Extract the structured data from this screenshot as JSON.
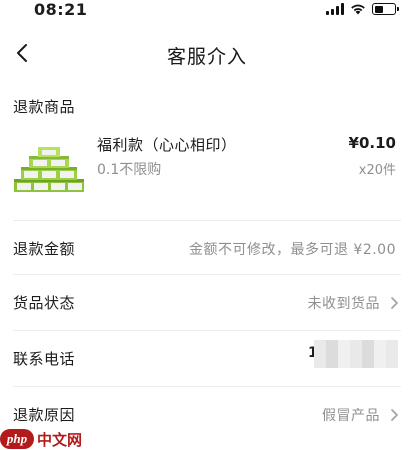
{
  "status_bar": {
    "time": "08:21",
    "icons": [
      "cellular-signal-icon",
      "wifi-icon",
      "battery-icon"
    ]
  },
  "nav": {
    "back_icon": "chevron-left-icon",
    "title": "客服介入"
  },
  "refund_item": {
    "section_label": "退款商品",
    "product_name": "福利款（心心相印）",
    "product_spec": "0.1不限购",
    "price": "¥0.10",
    "quantity": "x20件"
  },
  "refund_amount": {
    "label": "退款金额",
    "value": "金额不可修改，最多可退 ¥2.00"
  },
  "goods_status": {
    "label": "货品状态",
    "value": "未收到货品"
  },
  "contact_phone": {
    "label": "联系电话",
    "value_visible": "1"
  },
  "refund_reason": {
    "label": "退款原因",
    "value": "假冒产品"
  },
  "watermark": {
    "logo_text": "php",
    "site_text": "中文网"
  },
  "colors": {
    "text_primary": "#1c1c1c",
    "text_secondary": "#8f8f8f",
    "divider": "#ececec",
    "watermark": "#b31b1b"
  }
}
